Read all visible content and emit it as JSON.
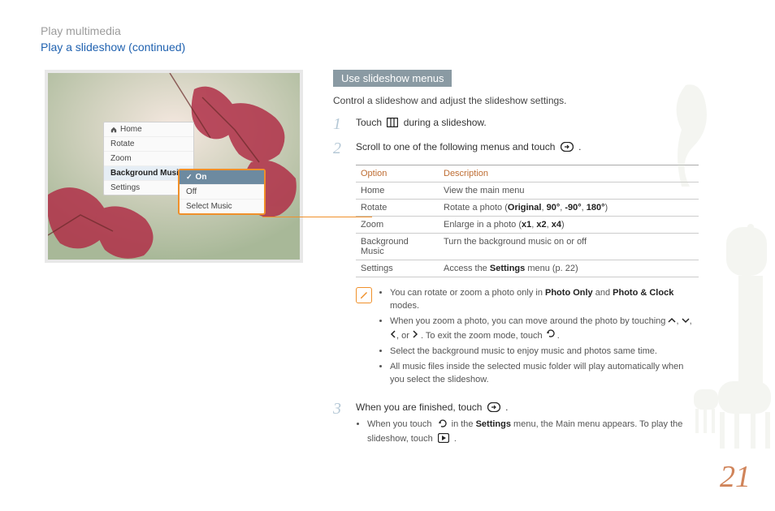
{
  "header": {
    "breadcrumb1": "Play multimedia",
    "breadcrumb2": "Play a slideshow  (continued)"
  },
  "screenshot_menu1": {
    "items": [
      "Home",
      "Rotate",
      "Zoom",
      "Background Music",
      "Settings"
    ],
    "selected_index": 3
  },
  "screenshot_menu2": {
    "items": [
      "On",
      "Off",
      "Select Music"
    ],
    "selected_index": 0
  },
  "section_heading": "Use slideshow menus",
  "intro": "Control a slideshow and adjust the slideshow settings.",
  "steps": {
    "s1_a": "Touch ",
    "s1_b": " during a slideshow.",
    "s2_a": "Scroll to one of the following menus and touch ",
    "s2_b": ".",
    "s3_a": "When you are finished, touch ",
    "s3_b": "."
  },
  "options_table": {
    "headers": [
      "Option",
      "Description"
    ],
    "rows": [
      {
        "option": "Home",
        "desc_plain": "View the main menu"
      },
      {
        "option": "Rotate",
        "desc_pre": "Rotate a photo (",
        "desc_bold": "Original",
        "desc_mid": ", ",
        "desc_bold2": "90°",
        "desc_mid2": ", ",
        "desc_bold3": "-90°",
        "desc_mid3": ", ",
        "desc_bold4": "180°",
        "desc_post": ")"
      },
      {
        "option": "Zoom",
        "desc_pre": "Enlarge in a photo (",
        "desc_bold": "x1",
        "desc_mid": ", ",
        "desc_bold2": "x2",
        "desc_mid2": ", ",
        "desc_bold3": "x4",
        "desc_post": ")"
      },
      {
        "option": "Background Music",
        "desc_plain": "Turn the background music on or off"
      },
      {
        "option": "Settings",
        "desc_pre": "Access the ",
        "desc_bold": "Settings",
        "desc_post": " menu (p. 22)"
      }
    ]
  },
  "note": {
    "b1_a": "You can rotate or zoom a photo only in ",
    "b1_bold1": "Photo Only",
    "b1_mid": " and ",
    "b1_bold2": "Photo & Clock",
    "b1_b": " modes.",
    "b2_a": "When you zoom a photo, you can move around the photo by touching ",
    "b2_mid": ", ",
    "b2_or": ", or ",
    "b2_b": ". To exit the zoom mode, touch ",
    "b2_c": ".",
    "b3": "Select the background music to enjoy music and photos same time.",
    "b4": "All music files inside the selected music folder will play automatically when you select the slideshow."
  },
  "step3_sub": {
    "a": "When you touch ",
    "b": " in the ",
    "bold": "Settings",
    "c": " menu, the Main menu appears. To play the slideshow, touch ",
    "d": "."
  },
  "page_number": "21"
}
